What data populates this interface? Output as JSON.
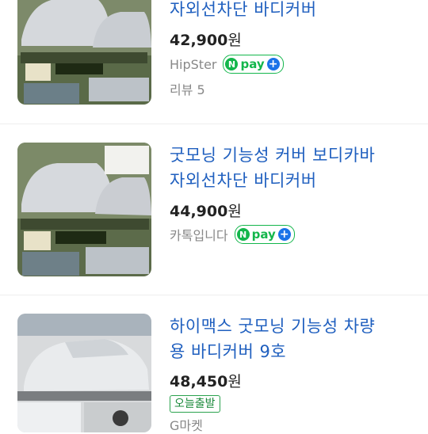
{
  "products": [
    {
      "title_line2": "자외선차단 바디커버",
      "price": "42,900",
      "currency": "원",
      "seller": "HipSter",
      "npay": {
        "n": "N",
        "label": "pay",
        "plus": "+"
      },
      "review": "리뷰 5"
    },
    {
      "title_line1": "굿모닝 기능성 커버 보디카바",
      "title_line2": "자외선차단 바디커버",
      "price": "44,900",
      "currency": "원",
      "seller": "카톡입니다",
      "npay": {
        "n": "N",
        "label": "pay",
        "plus": "+"
      }
    },
    {
      "title_line1": "하이맥스 굿모닝 기능성 차량",
      "title_line2": "용 바디커버 9호",
      "price": "48,450",
      "currency": "원",
      "badge": "오늘출발",
      "seller": "G마켓"
    }
  ],
  "colors": {
    "title": "#1f5fbf",
    "npay_green": "#13b64b",
    "badge_green": "#2aa24d"
  }
}
